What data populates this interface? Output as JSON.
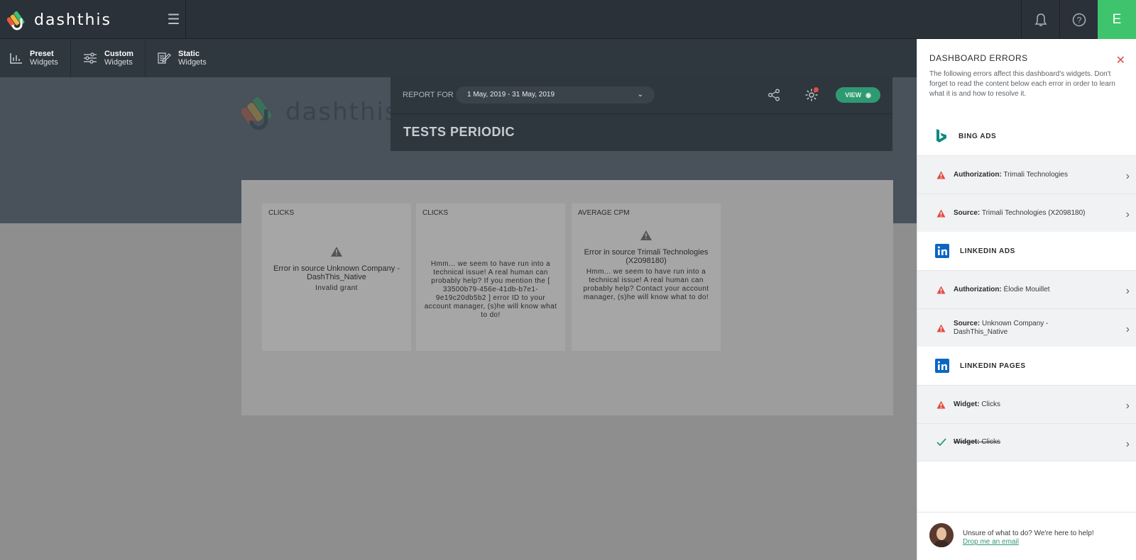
{
  "app": {
    "logo_text": "dashthis",
    "user_initial": "E"
  },
  "widget_toolbar": [
    {
      "title": "Preset",
      "subtitle": "Widgets",
      "icon": "bar-chart-icon"
    },
    {
      "title": "Custom",
      "subtitle": "Widgets",
      "icon": "sliders-icon"
    },
    {
      "title": "Static",
      "subtitle": "Widgets",
      "icon": "edit-doc-icon"
    }
  ],
  "header": {
    "report_for": "REPORT FOR",
    "date_range": "1 May, 2019 - 31 May, 2019",
    "view_label": "VIEW",
    "title": "TESTS PERIODIC"
  },
  "background_logo": "dashthis",
  "widgets": [
    {
      "title": "CLICKS",
      "error": "Error in source Unknown Company - DashThis_Native",
      "message": "Invalid grant"
    },
    {
      "title": "CLICKS",
      "error": "",
      "message": "Hmm... we seem to have run into a technical issue! A real human can probably help? If you mention the [ 33500b79-456e-41db-b7e1-9e19c20db5b2 ] error ID to your account manager, (s)he will know what to do!"
    },
    {
      "title": "AVERAGE CPM",
      "error": "Error in source Trimali Technologies (X2098180)",
      "message": "Hmm... we seem to have run into a technical issue! A real human can probably help? Contact your account manager, (s)he will know what to do!"
    }
  ],
  "panel": {
    "title": "DASHBOARD ERRORS",
    "description": "The following errors affect this dashboard's widgets. Don't forget to read the content below each error in order to learn what it is and how to resolve it.",
    "sections": [
      {
        "name": "BING ADS",
        "rows": [
          {
            "label": "Authorization:",
            "value": "Trimali Technologies",
            "status": "error"
          },
          {
            "label": "Source:",
            "value": "Trimali Technologies (X2098180)",
            "status": "error"
          }
        ]
      },
      {
        "name": "LINKEDIN ADS",
        "rows": [
          {
            "label": "Authorization:",
            "value": "Élodie Mouillet",
            "status": "error"
          },
          {
            "label": "Source:",
            "value": "Unknown Company - DashThis_Native",
            "status": "error"
          }
        ]
      },
      {
        "name": "LINKEDIN PAGES",
        "rows": [
          {
            "label": "Widget:",
            "value": "Clicks",
            "status": "error"
          },
          {
            "label": "Widget:",
            "value": "Clicks",
            "status": "resolved"
          }
        ]
      }
    ],
    "footer": {
      "help_text": "Unsure of what to do? We're here to help!",
      "link": "Drop me an email"
    }
  },
  "colors": {
    "accent_green": "#3ec46d",
    "error_red": "#e14b45",
    "link_green": "#2f9a72",
    "bing_teal": "#0d8a82",
    "linkedin_blue": "#0a66c2"
  }
}
